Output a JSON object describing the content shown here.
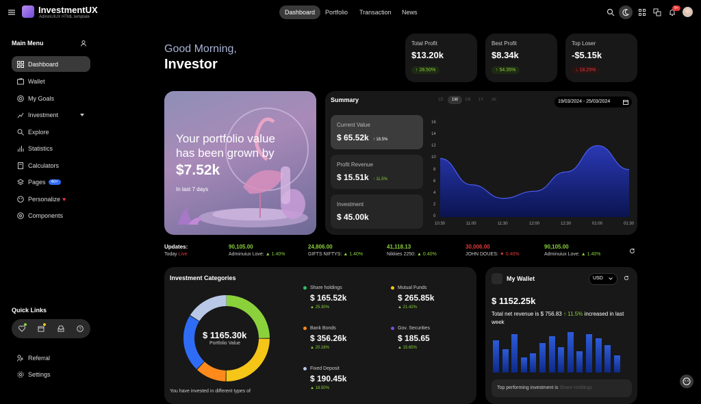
{
  "brand": {
    "title": "InvestmentUX",
    "subtitle": "AdminUIUX HTML template"
  },
  "topnav": [
    {
      "label": "Dashboard",
      "active": true
    },
    {
      "label": "Portfolio"
    },
    {
      "label": "Transaction"
    },
    {
      "label": "News"
    }
  ],
  "notification_badge": "9+",
  "sidebar": {
    "heading": "Main Menu",
    "items": [
      {
        "label": "Dashboard",
        "icon": "grid-icon",
        "active": true
      },
      {
        "label": "Wallet",
        "icon": "wallet-icon"
      },
      {
        "label": "My Goals",
        "icon": "target-icon"
      },
      {
        "label": "Investment",
        "icon": "investment-icon"
      },
      {
        "label": "Explore",
        "icon": "search-icon"
      },
      {
        "label": "Statistics",
        "icon": "bar-chart-icon"
      },
      {
        "label": "Calculators",
        "icon": "calculator-icon"
      },
      {
        "label": "Pages",
        "icon": "layers-icon",
        "badge": "40+"
      },
      {
        "label": "Personalize",
        "icon": "palette-icon"
      },
      {
        "label": "Components",
        "icon": "components-icon"
      }
    ],
    "quick_links_heading": "Quick Links",
    "bottom_items": [
      {
        "label": "Referral",
        "icon": "referral-icon"
      },
      {
        "label": "Settings",
        "icon": "settings-icon"
      }
    ]
  },
  "greeting": {
    "line1": "Good Morning,",
    "line2": "Investor"
  },
  "stats": [
    {
      "title": "Total Profit",
      "value": "$13.20k",
      "change": "28.50%",
      "dir": "up"
    },
    {
      "title": "Best Profit",
      "value": "$8.34k",
      "change": "54.35%",
      "dir": "up"
    },
    {
      "title": "Top Loser",
      "value": "-$5.15k",
      "change": "18.25%",
      "dir": "down"
    }
  ],
  "hero": {
    "line1": "Your portfolio value",
    "line2": "has been grown by",
    "amount": "$7.52k",
    "sub": "In last 7 days"
  },
  "summary": {
    "title": "Summary",
    "ranges": [
      "1D",
      "1W",
      "1M",
      "1Y",
      "All"
    ],
    "active_range": "1W",
    "date_range": "19/03/2024 - 25/03/2024",
    "boxes": [
      {
        "label": "Current Value",
        "value": "$ 65.52k",
        "change": "18.5%"
      },
      {
        "label": "Profit Revenue",
        "value": "$ 15.51k",
        "change": "11.5%"
      },
      {
        "label": "Investment",
        "value": "$ 45.00k",
        "change": ""
      }
    ]
  },
  "chart_data": {
    "type": "area",
    "x": [
      "10:30",
      "11:00",
      "11:30",
      "12:00",
      "12:30",
      "01:00",
      "01:30"
    ],
    "y_ticks": [
      0,
      2,
      4,
      6,
      8,
      10,
      12,
      14,
      16
    ],
    "ylim": [
      0,
      16
    ],
    "values": [
      10,
      5.5,
      3.2,
      4.4,
      7.7,
      12.2,
      8.1
    ],
    "series_color": "#3d4fd8"
  },
  "updates": {
    "title": "Updates:",
    "today": "Today",
    "live": "Live",
    "items": [
      {
        "value": "90,105.00",
        "name": "Adminuiux Love:",
        "change": "1.40%",
        "dir": "up"
      },
      {
        "value": "24,806.00",
        "name": "GIFTS NIFTYS:",
        "change": "1.40%",
        "dir": "up"
      },
      {
        "value": "41,118.13",
        "name": "Nikkies 2250:",
        "change": "0.40%",
        "dir": "up"
      },
      {
        "value": "30,006.00",
        "name": "JOHN DOUES:",
        "change": "0.40%",
        "dir": "down"
      },
      {
        "value": "90,105.00",
        "name": "Adminuiux Love:",
        "change": "1.40%",
        "dir": "up"
      }
    ]
  },
  "categories": {
    "title": "Investment Categories",
    "center_value": "$ 1165.30k",
    "center_label": "Portfolio Value",
    "footer": "You have invested in different types of",
    "items": [
      {
        "name": "Share holdings",
        "amount": "$ 165.52k",
        "pct": "25.30%",
        "color": "#8bd13b"
      },
      {
        "name": "Mutual Funds",
        "amount": "$ 265.85k",
        "pct": "21.42%",
        "color": "#f5c518"
      },
      {
        "name": "Bank Bonds",
        "amount": "$ 356.26k",
        "pct": "20.18%",
        "color": "#ff8a1c"
      },
      {
        "name": "Gov. Securities",
        "amount": "$ 185.65",
        "pct": "15.65%",
        "color": "#2f6cf6"
      },
      {
        "name": "Fixed Deposit",
        "amount": "$ 190.45k",
        "pct": "18.50%",
        "color": "#b8c8e6"
      }
    ]
  },
  "wallet": {
    "title": "My Wallet",
    "currency": "USD",
    "balance": "$ 1152.25k",
    "text1": "Total net revenue is $ 756.83",
    "change": "11.5%",
    "text2": "increased in last week",
    "footer": "Top performing investment is",
    "footer_highlight": "Share Holdings",
    "bars": [
      0.75,
      0.55,
      0.9,
      0.35,
      0.45,
      0.7,
      0.85,
      0.6,
      0.95,
      0.5,
      0.9,
      0.8,
      0.65,
      0.4
    ]
  }
}
